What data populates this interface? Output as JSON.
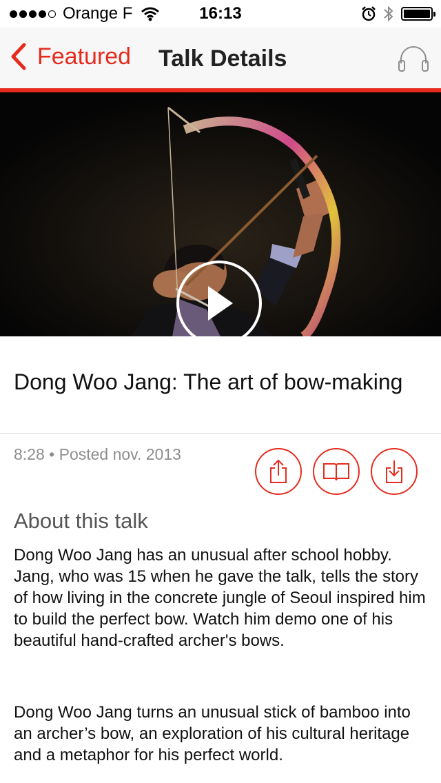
{
  "status_bar": {
    "carrier": "Orange F",
    "time": "16:13",
    "signal_filled": 4,
    "signal_total": 5
  },
  "nav": {
    "back_label": "Featured",
    "title": "Talk Details",
    "accent_color": "#e62b1e"
  },
  "talk": {
    "title": "Dong Woo Jang: The art of bow-making",
    "meta": "8:28 • Posted nov. 2013",
    "about_heading": "About this talk",
    "description": "Dong Woo Jang has an unusual after school hobby. Jang, who was 15 when he gave the talk, tells the story of how living in the concrete jungle of Seoul inspired him to build the perfect bow. Watch him demo one of his beautiful hand-crafted archer's bows.",
    "description2": "Dong Woo Jang turns an unusual stick of bamboo into an archer’s bow, an exploration of his cultural heritage and a metaphor for his perfect world."
  },
  "icons": {
    "back": "chevron-left-icon",
    "audio": "headphones-icon",
    "play": "play-icon",
    "share": "share-icon",
    "read": "book-icon",
    "download": "download-icon"
  }
}
